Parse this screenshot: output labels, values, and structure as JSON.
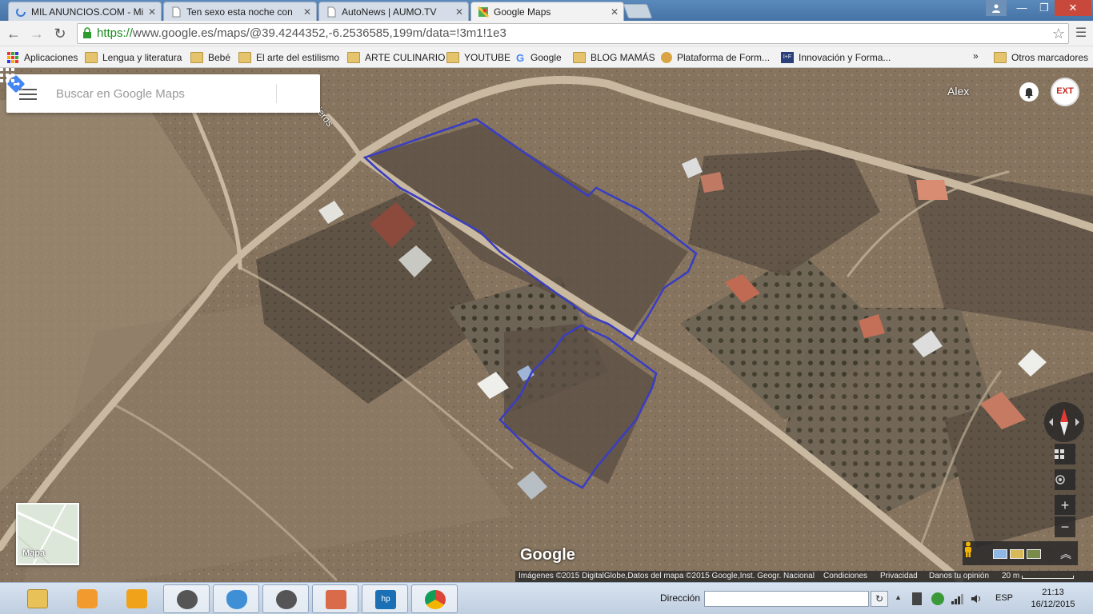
{
  "browser": {
    "tabs": [
      {
        "label": "MIL ANUNCIOS.COM - Mi",
        "close": "✕",
        "active": false
      },
      {
        "label": "Ten sexo esta noche con",
        "close": "✕",
        "active": false
      },
      {
        "label": "AutoNews | AUMO.TV",
        "close": "✕",
        "active": false
      },
      {
        "label": "Google Maps",
        "close": "✕",
        "active": true
      }
    ],
    "url_https": "https://",
    "url_rest": "www.google.es/maps/@39.4244352,-6.2536585,199m/data=!3m1!1e3",
    "bookmarks": [
      {
        "label": "Aplicaciones",
        "icon": "apps-grid-icon"
      },
      {
        "label": "Lengua y literatura",
        "icon": "folder-icon"
      },
      {
        "label": "Bebé",
        "icon": "folder-icon"
      },
      {
        "label": "El arte del estilismo",
        "icon": "folder-icon"
      },
      {
        "label": "ARTE CULINARIO",
        "icon": "folder-icon"
      },
      {
        "label": "YOUTUBE",
        "icon": "folder-icon"
      },
      {
        "label": "Google",
        "icon": "google-g-icon"
      },
      {
        "label": "BLOG MAMÁS",
        "icon": "folder-icon"
      },
      {
        "label": "Plataforma de Form...",
        "icon": "globe-icon"
      },
      {
        "label": "Innovación y Forma...",
        "icon": "iyf-icon"
      }
    ],
    "bookmarks_more": "»",
    "other_bookmarks": "Otros marcadores"
  },
  "maps": {
    "search_placeholder": "Buscar en Google Maps",
    "user_name": "Alex",
    "avatar_text": "EXT",
    "street_label": "vieros",
    "minimap_label": "Mapa",
    "logo": "Google",
    "attribution": {
      "imagery": "Imágenes ©2015 DigitalGlobe,Datos del mapa ©2015 Google,Inst. Geogr. Nacional",
      "terms": "Condiciones",
      "privacy": "Privacidad",
      "feedback": "Danos tu opinión",
      "scale": "20 m"
    },
    "zoom_in": "+",
    "zoom_out": "−"
  },
  "taskbar": {
    "address_label": "Dirección",
    "address_value": "",
    "language": "ESP",
    "time": "21:13",
    "date": "16/12/2015"
  },
  "colors": {
    "parcel_outline": "#3a3ec0",
    "road": "#c9b9a0",
    "satellite_ground": "#8a7a66"
  }
}
